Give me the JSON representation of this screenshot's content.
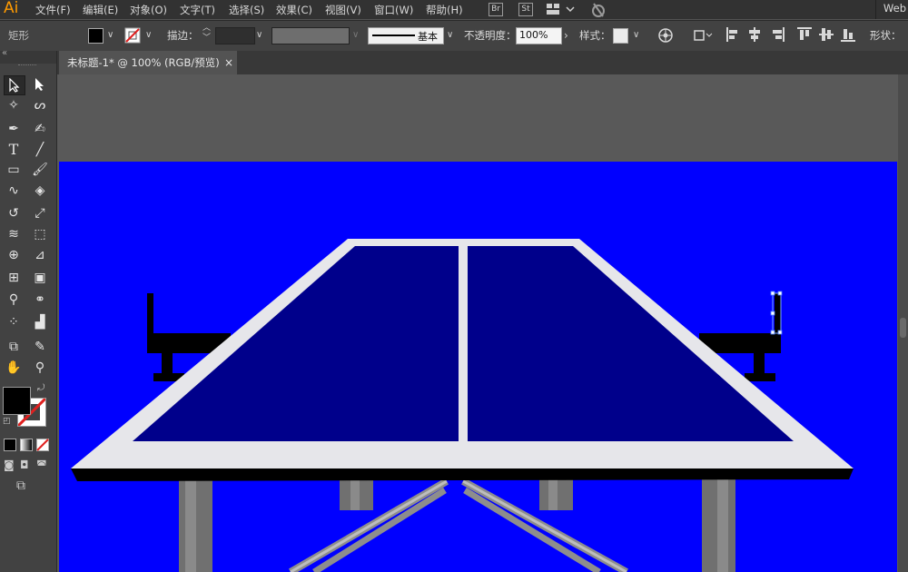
{
  "app": {
    "logo": "Ai"
  },
  "menu": [
    "文件(F)",
    "编辑(E)",
    "对象(O)",
    "文字(T)",
    "选择(S)",
    "效果(C)",
    "视图(V)",
    "窗口(W)",
    "帮助(H)"
  ],
  "menu_icons": [
    "Br",
    "St"
  ],
  "workspace": "Web",
  "options": {
    "shape_label": "矩形",
    "stroke_label": "描边：",
    "brush_value": "基本",
    "opacity_label": "不透明度：",
    "opacity_value": "100%",
    "style_label": "样式：",
    "shape_right_label": "形状："
  },
  "document_tab": {
    "title": "未标题-1* @ 100% (RGB/预览)",
    "close": "×"
  },
  "colors": {
    "accent_logo": "#ff9a00",
    "artboard_bg": "#0000ff",
    "table_surface": "#00008b",
    "table_border": "#e6e6ea",
    "net": "#000000"
  }
}
